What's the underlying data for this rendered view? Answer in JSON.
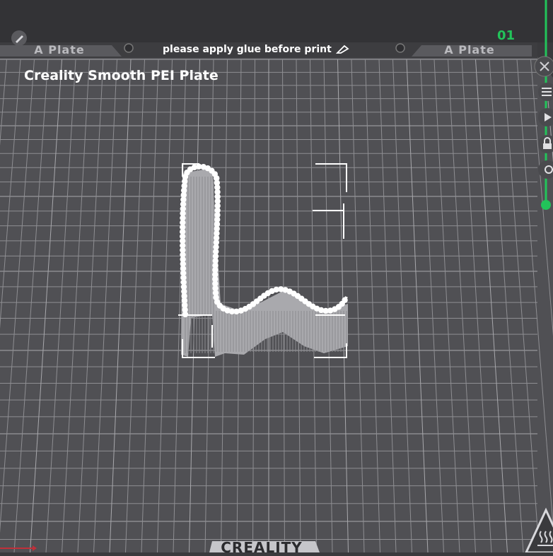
{
  "header": {
    "plate_left_label": "A Plate",
    "plate_right_label": "A Plate",
    "glue_notice": "please apply glue before print"
  },
  "bed": {
    "title": "Creality Smooth PEI Plate",
    "logo": "CREALITY"
  },
  "layer_slider": {
    "layer_number": "01",
    "level": 1.0,
    "color": "#22c45a"
  },
  "toolbar": {
    "icons": [
      "close-icon",
      "layers-icon",
      "play-icon",
      "lock-icon",
      "settings-icon"
    ]
  },
  "colors": {
    "background": "#3a3a3d",
    "bed": "#505054",
    "grid_line": "#9a9a9e",
    "model": "#c8c8cc",
    "accent": "#22c45a"
  },
  "icons": [
    "edit-icon",
    "pencil-icon",
    "heated-bed-icon",
    "axis-indicator-icon"
  ]
}
